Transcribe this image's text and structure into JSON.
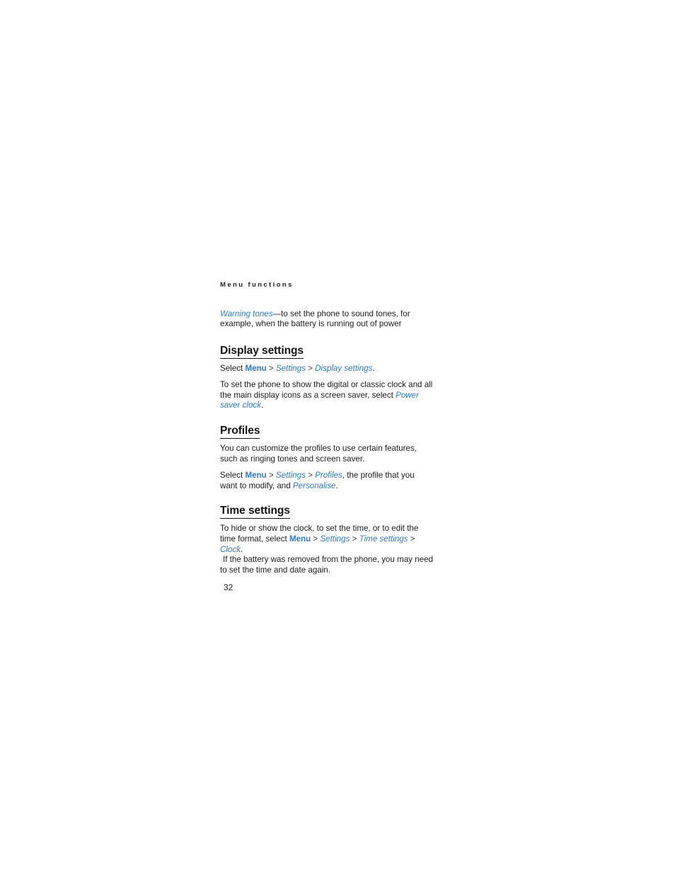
{
  "page": {
    "running_header": "Menu functions",
    "folio": "32",
    "link_color": "#2e7ad1",
    "text_color": "#1b1b1b"
  },
  "intro": {
    "term": "Warning tones",
    "dash": "—",
    "text": "to set the phone to sound tones, for example, when the battery is running out of power"
  },
  "sections": [
    {
      "heading": "Display settings",
      "paragraphs": [
        {
          "id": "display-path",
          "lead": "Select ",
          "path": [
            "Menu",
            "Settings",
            "Display settings"
          ],
          "separator": ">",
          "trail": "."
        },
        {
          "id": "display-saver",
          "lead": "To set the phone to show the digital or classic clock and all the main display icons as a screen saver, select ",
          "emphasis": "Power saver clock",
          "trail": "."
        }
      ]
    },
    {
      "heading": "Profiles",
      "paragraphs": [
        {
          "id": "profiles-intro",
          "lead": "You can customize the profiles to use certain features, such as ringing tones and screen saver."
        },
        {
          "id": "profiles-path",
          "lead": "Select ",
          "path": [
            "Menu",
            "Settings",
            "Profiles"
          ],
          "separator": ">",
          "middle": ", the profile that you want to modify, and ",
          "emphasis": "Personalise",
          "trail": "."
        }
      ]
    },
    {
      "heading": "Time settings",
      "paragraphs": [
        {
          "id": "time-path",
          "lead": "To hide or show the clock, to set the time, or to edit the time format, select ",
          "path": [
            "Menu",
            "Settings",
            "Time settings",
            "Clock"
          ],
          "separator": ">",
          "trail": "."
        },
        {
          "id": "time-tip",
          "lead": "If the battery was removed from the phone, you may need to set the time and date again."
        }
      ]
    }
  ]
}
